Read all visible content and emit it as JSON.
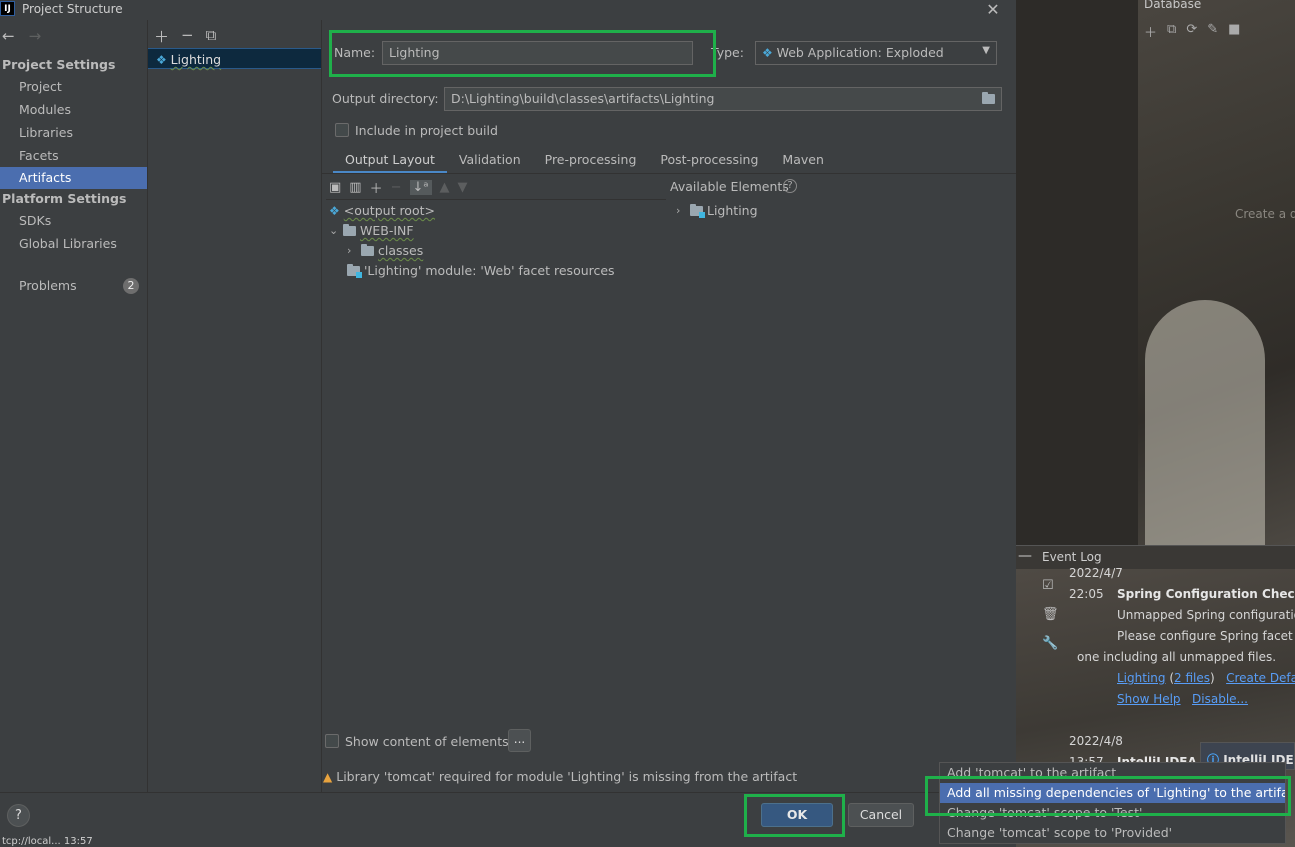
{
  "window": {
    "title": "Project Structure",
    "app_icon": "IJ"
  },
  "nav": {
    "project_settings": "Project Settings",
    "project_items": [
      "Project",
      "Modules",
      "Libraries",
      "Facets",
      "Artifacts"
    ],
    "platform_settings": "Platform Settings",
    "platform_items": [
      "SDKs",
      "Global Libraries"
    ],
    "problems_label": "Problems",
    "problems_count": "2",
    "selected": "Artifacts"
  },
  "artifacts": {
    "items": [
      "Lighting"
    ]
  },
  "form": {
    "name_label": "Name:",
    "name_value": "Lighting",
    "type_label": "Type:",
    "type_value": "Web Application: Exploded",
    "output_dir_label": "Output directory:",
    "output_dir_value": "D:\\Lighting\\build\\classes\\artifacts\\Lighting",
    "include_label": "Include in project build"
  },
  "tabs": [
    "Output Layout",
    "Validation",
    "Pre-processing",
    "Post-processing",
    "Maven"
  ],
  "active_tab": "Output Layout",
  "tree": {
    "root": "<output root>",
    "webinf": "WEB-INF",
    "classes": "classes",
    "facet": "'Lighting' module: 'Web' facet resources"
  },
  "available": {
    "label": "Available Elements",
    "items": [
      "Lighting"
    ]
  },
  "show_content_label": "Show content of elements",
  "ellipsis_label": "...",
  "warning": "Library 'tomcat' required for module 'Lighting' is missing from the artifact",
  "buttons": {
    "ok": "OK",
    "cancel": "Cancel",
    "help": "?"
  },
  "popup": {
    "items": [
      "Add 'tomcat' to the artifact",
      "Add all missing dependencies of 'Lighting' to the artifact",
      "Change 'tomcat' scope to 'Test'",
      "Change 'tomcat' scope to 'Provided'"
    ],
    "selected_index": 1
  },
  "database": {
    "title": "Database",
    "hint": "Create a d"
  },
  "event_log": {
    "title": "Event Log",
    "date1": "2022/4/7",
    "time1": "22:05",
    "heading": "Spring Configuration Check",
    "line1": "Unmapped Spring configuratio",
    "line2": "Please configure Spring facet o",
    "line3": "one including all unmapped files.",
    "link_lighting": "Lighting",
    "link_files": "2 files",
    "link_create": "Create Defau",
    "link_help": "Show Help",
    "link_disable": "Disable...",
    "date2": "2022/4/8",
    "time2": "13:57",
    "entry2": "IntelliJ IDEA",
    "notif": "IntelliJ IDE"
  },
  "status_text": "tcp://local... 13:57"
}
